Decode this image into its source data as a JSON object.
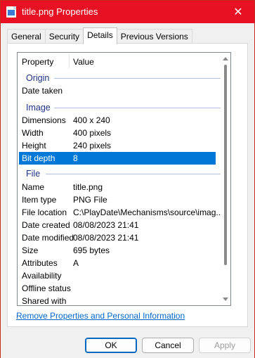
{
  "window": {
    "title": "title.png Properties",
    "close_glyph": "✕",
    "icon": "image-file-icon",
    "accent_color": "#e81123"
  },
  "tabs": [
    {
      "label": "General",
      "active": false
    },
    {
      "label": "Security",
      "active": false
    },
    {
      "label": "Details",
      "active": true
    },
    {
      "label": "Previous Versions",
      "active": false
    }
  ],
  "list": {
    "columns": {
      "property": "Property",
      "value": "Value"
    },
    "groups": {
      "origin": "Origin",
      "image": "Image",
      "file": "File"
    },
    "origin_rows": [
      {
        "key": "Date taken",
        "value": ""
      }
    ],
    "image_rows": [
      {
        "key": "Dimensions",
        "value": "400 x 240"
      },
      {
        "key": "Width",
        "value": "400 pixels"
      },
      {
        "key": "Height",
        "value": "240 pixels"
      },
      {
        "key": "Bit depth",
        "value": "8",
        "selected": true
      }
    ],
    "file_rows": [
      {
        "key": "Name",
        "value": "title.png"
      },
      {
        "key": "Item type",
        "value": "PNG File"
      },
      {
        "key": "File location",
        "value": "C:\\PlayDate\\Mechanisms\\source\\imag..."
      },
      {
        "key": "Date created",
        "value": "08/08/2023 21:41"
      },
      {
        "key": "Date modified",
        "value": "08/08/2023 21:41"
      },
      {
        "key": "Size",
        "value": "695 bytes"
      },
      {
        "key": "Attributes",
        "value": "A"
      },
      {
        "key": "Availability",
        "value": ""
      },
      {
        "key": "Offline status",
        "value": ""
      },
      {
        "key": "Shared with",
        "value": ""
      }
    ],
    "selection_color": "#0078d7"
  },
  "remove_link": "Remove Properties and Personal Information",
  "buttons": {
    "ok": "OK",
    "cancel": "Cancel",
    "apply": "Apply"
  }
}
